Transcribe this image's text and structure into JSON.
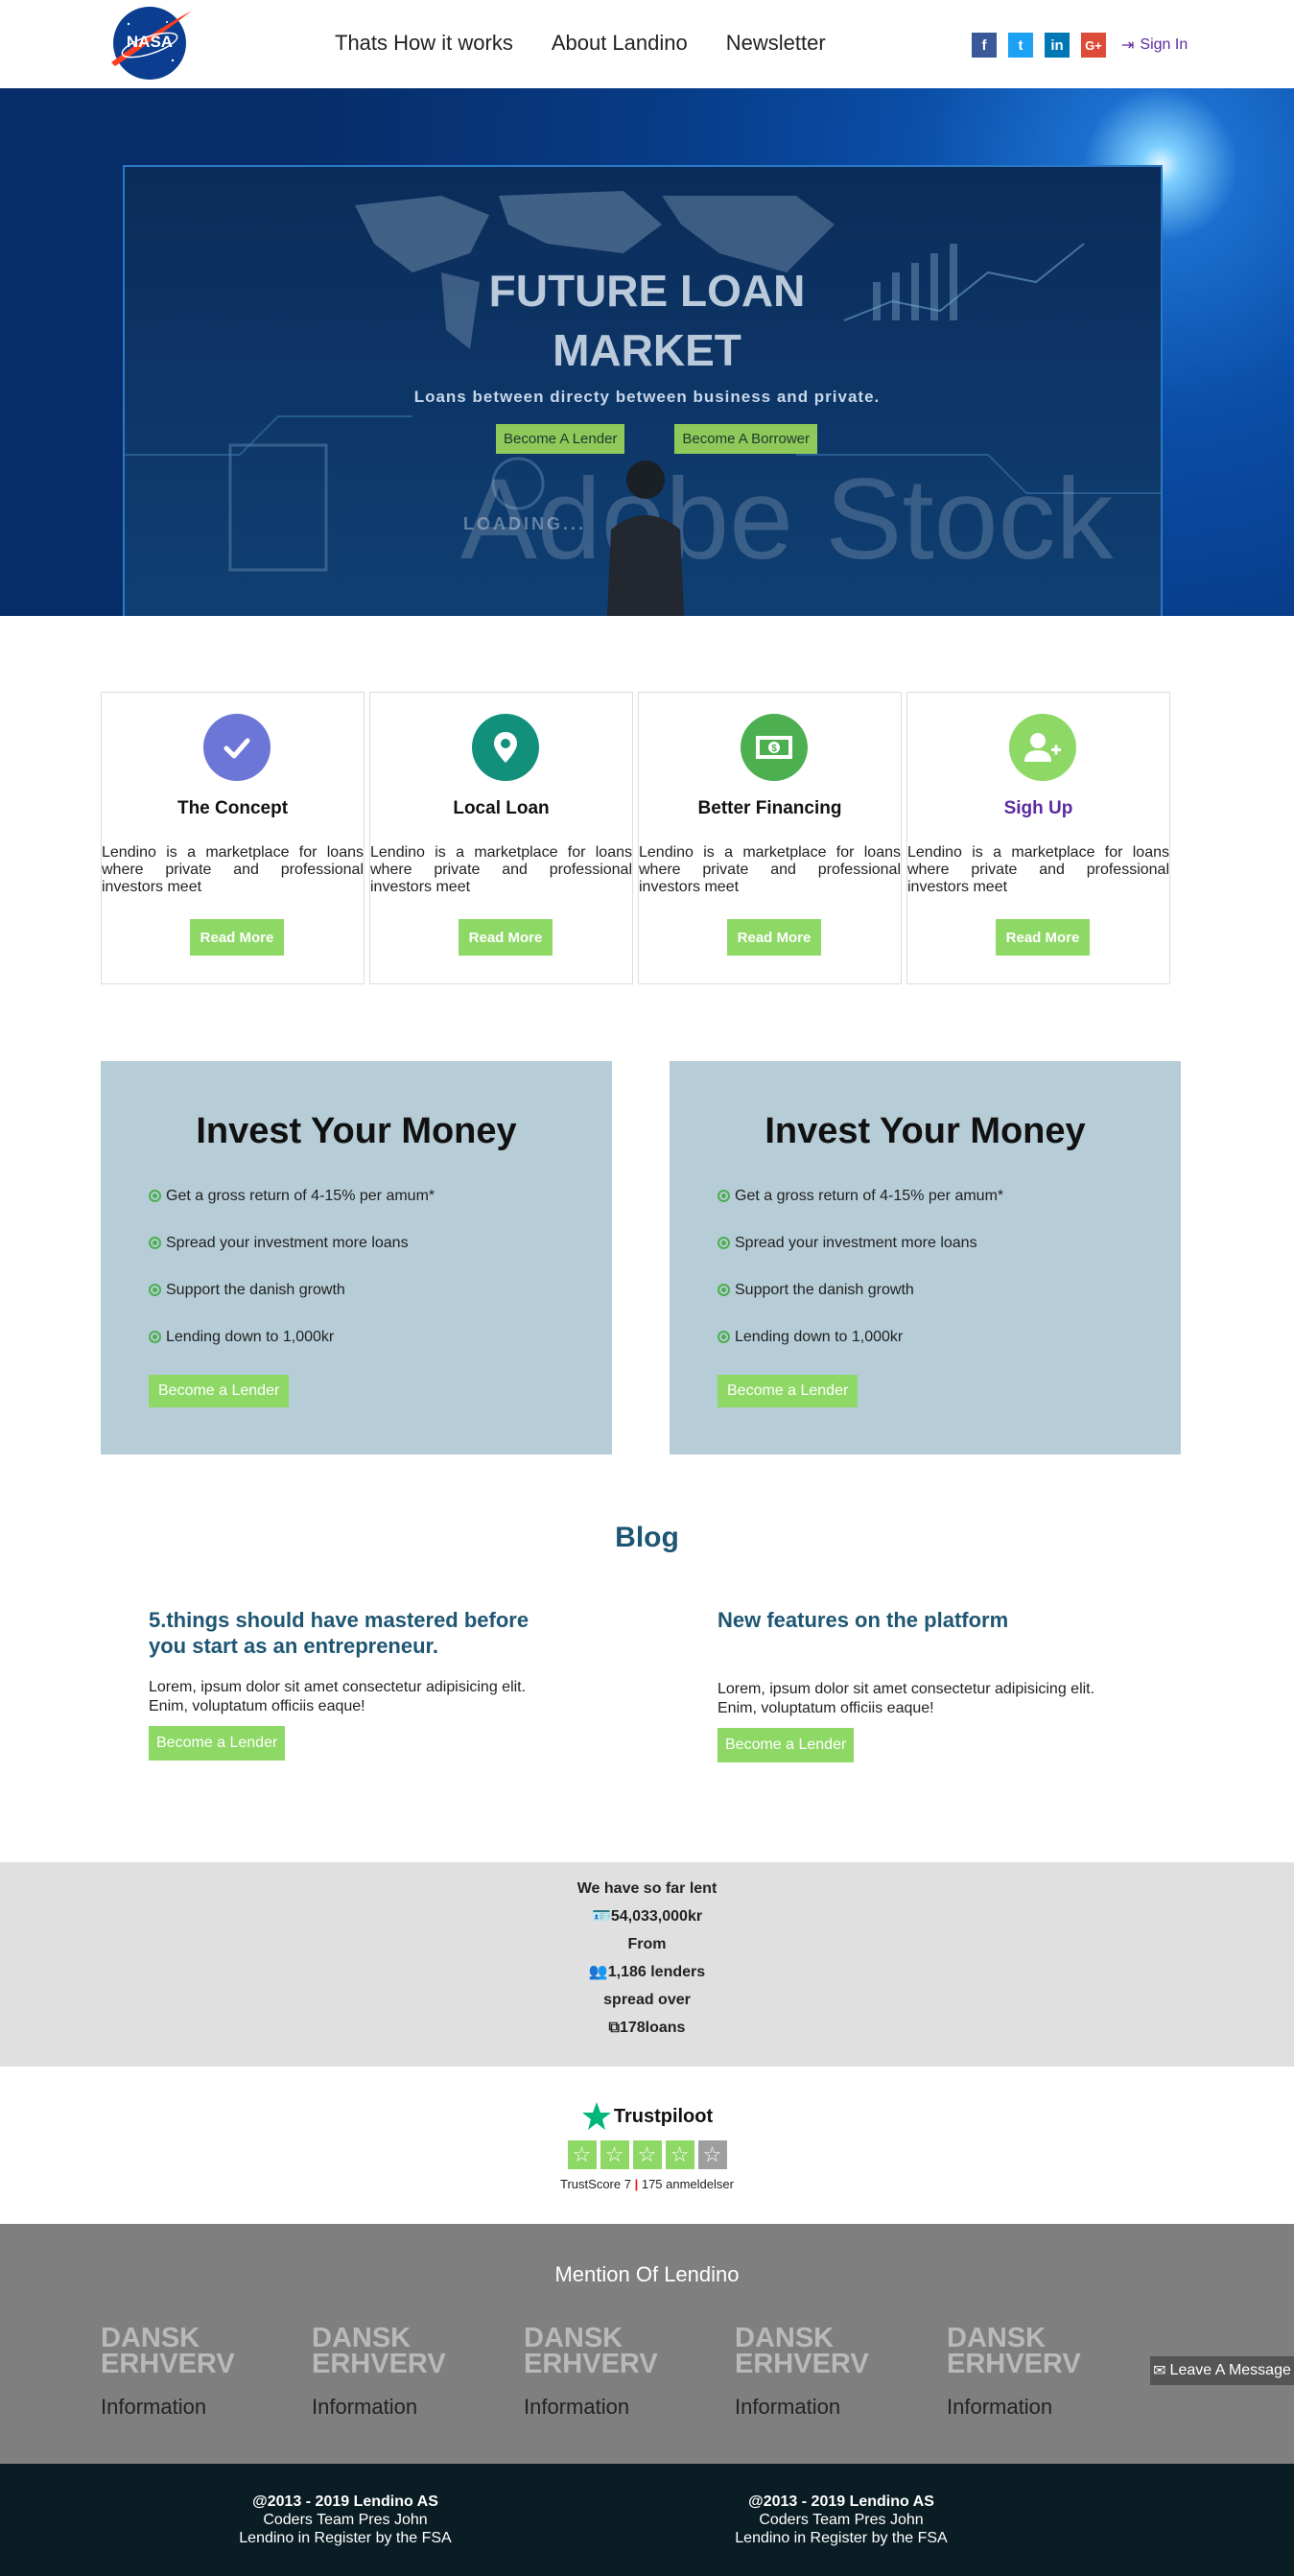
{
  "header": {
    "logo_text": "NASA",
    "nav": [
      "Thats How it works",
      "About Landino",
      "Newsletter"
    ],
    "social": [
      {
        "name": "facebook",
        "glyph": "f",
        "color": "#3b5998"
      },
      {
        "name": "twitter",
        "glyph": "t",
        "color": "#1da1f2"
      },
      {
        "name": "linkedin",
        "glyph": "in",
        "color": "#0077b5"
      },
      {
        "name": "google-plus",
        "glyph": "G+",
        "color": "#dd4b39"
      }
    ],
    "signin": "Sign In"
  },
  "hero": {
    "title_line1": "FUTURE LOAN",
    "title_line2": "MARKET",
    "subtitle": "Loans between directy between business and private.",
    "btn_lender": "Become A Lender",
    "btn_borrower": "Become A Borrower",
    "watermark": "Adobe Stock",
    "loading": "LOADING..."
  },
  "features": [
    {
      "title": "The Concept",
      "text": "Lendino is a marketplace for loans where private and professional investors meet",
      "button": "Read More",
      "icon": "check-icon",
      "color": "#6b76d6"
    },
    {
      "title": "Local Loan",
      "text": "Lendino is a marketplace for loans where private and professional investors meet",
      "button": "Read More",
      "icon": "map-pin-icon",
      "color": "#12907c"
    },
    {
      "title": "Better Financing",
      "text": "Lendino is a marketplace for loans where private and professional investors meet",
      "button": "Read More",
      "icon": "money-icon",
      "color": "#4caf50"
    },
    {
      "title": "Sigh Up",
      "text": "Lendino is a marketplace for loans where private and professional investors meet",
      "button": "Read More",
      "icon": "user-plus-icon",
      "color": "#8ed866"
    }
  ],
  "invest": [
    {
      "title": "Invest Your Money",
      "items": [
        "Get a gross return of 4-15% per amum*",
        "Spread your investment more loans",
        "Support the danish growth",
        "Lending down to 1,000kr"
      ],
      "button": "Become a Lender"
    },
    {
      "title": "Invest Your Money",
      "items": [
        "Get a gross return of 4-15% per amum*",
        "Spread your investment more loans",
        "Support the danish growth",
        "Lending down to 1,000kr"
      ],
      "button": "Become a Lender"
    }
  ],
  "blog": {
    "title": "Blog",
    "posts": [
      {
        "title": "5.things should have mastered before you start as an entrepreneur.",
        "text": "Lorem, ipsum dolor sit amet consectetur adipisicing elit. Enim, voluptatum officiis eaque!",
        "button": "Become a Lender"
      },
      {
        "title": "New features on the platform",
        "text": "Lorem, ipsum dolor sit amet consectetur adipisicing elit. Enim, voluptatum officiis eaque!",
        "button": "Become a Lender"
      }
    ]
  },
  "stats": {
    "line1": "We have so far lent",
    "amount": "54,033,000kr",
    "line2": "From",
    "lenders": "1,186 lenders",
    "line3": "spread over",
    "loans": "178loans"
  },
  "trust": {
    "brand": "Trustpiloot",
    "rating": 4,
    "max": 5,
    "score_label": "TrustScore 7",
    "reviews": "175 anmeldelser"
  },
  "mention": {
    "title": "Mention Of Lendino",
    "items": [
      {
        "logo_line1": "DANSK",
        "logo_line2": "ERHVERV",
        "label": "Information"
      },
      {
        "logo_line1": "DANSK",
        "logo_line2": "ERHVERV",
        "label": "Information"
      },
      {
        "logo_line1": "DANSK",
        "logo_line2": "ERHVERV",
        "label": "Information"
      },
      {
        "logo_line1": "DANSK",
        "logo_line2": "ERHVERV",
        "label": "Information"
      },
      {
        "logo_line1": "DANSK",
        "logo_line2": "ERHVERV",
        "label": "Information"
      }
    ],
    "leave_message": "Leave A Message"
  },
  "footer": [
    {
      "line1": "@2013 - 2019 Lendino AS",
      "line2": "Coders Team Pres John",
      "line3": "Lendino in Register by the FSA"
    },
    {
      "line1": "@2013 - 2019 Lendino AS",
      "line2": "Coders Team Pres John",
      "line3": "Lendino in Register by the FSA"
    }
  ]
}
